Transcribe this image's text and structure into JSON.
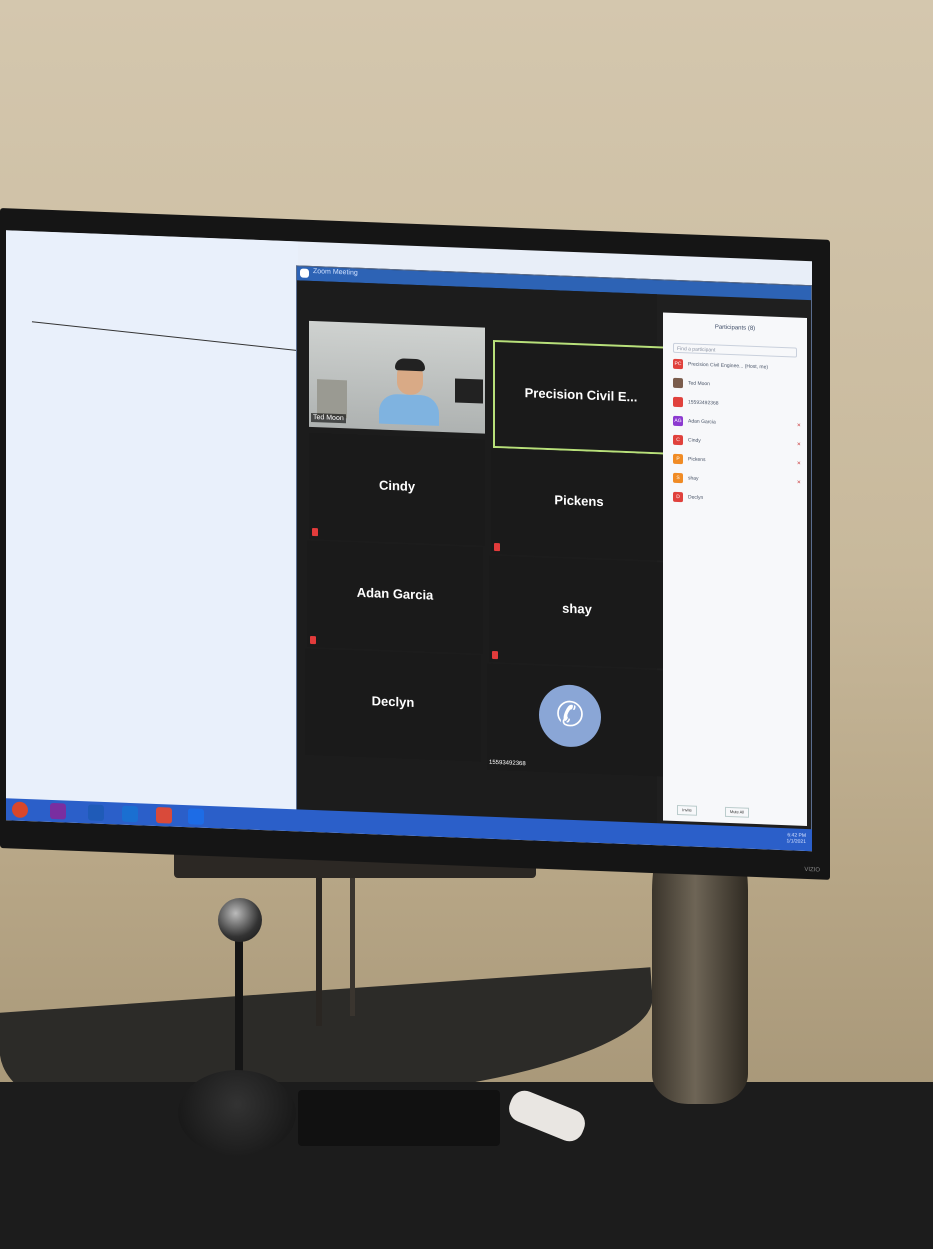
{
  "zoom": {
    "window_title": "Zoom Meeting",
    "tiles": [
      {
        "name": "Ted Moon",
        "type": "video",
        "muted": false
      },
      {
        "name": "Precision Civil E...",
        "type": "name",
        "muted": false,
        "active_speaker": true
      },
      {
        "name": "Cindy",
        "type": "name",
        "muted": true
      },
      {
        "name": "Pickens",
        "type": "name",
        "muted": true
      },
      {
        "name": "Adan Garcia",
        "type": "name",
        "muted": true
      },
      {
        "name": "shay",
        "type": "name",
        "muted": true
      },
      {
        "name": "Declyn",
        "type": "name",
        "muted": false
      },
      {
        "name": "15593492368",
        "type": "phone",
        "muted": false
      }
    ],
    "participants_panel": {
      "title": "Participants (8)",
      "search_placeholder": "Find a participant",
      "items": [
        {
          "initials": "PC",
          "name": "Precision Civil Enginee... (Host, me)",
          "color": "#e0413c"
        },
        {
          "initials": "",
          "name": "Ted Moon",
          "color": "#7a5c4c"
        },
        {
          "initials": "",
          "name": "15593492368",
          "color": "#e0413c"
        },
        {
          "initials": "AG",
          "name": "Adan Garcia",
          "color": "#8c39d0"
        },
        {
          "initials": "C",
          "name": "Cindy",
          "color": "#e0413c"
        },
        {
          "initials": "P",
          "name": "Pickens",
          "color": "#f08b24"
        },
        {
          "initials": "S",
          "name": "shay",
          "color": "#f08b24"
        },
        {
          "initials": "D",
          "name": "Declyn",
          "color": "#e0413c"
        }
      ],
      "invite_label": "Invite",
      "mute_all_label": "Mute All"
    }
  },
  "taskbar": {
    "clock": "6:42 PM",
    "date": "1/1/2021",
    "app_icons": [
      "powerpoint-icon",
      "onenote-icon",
      "word-icon",
      "outlook-icon",
      "files-icon",
      "zoom-icon"
    ]
  },
  "tv": {
    "brand": "VIZIO"
  }
}
